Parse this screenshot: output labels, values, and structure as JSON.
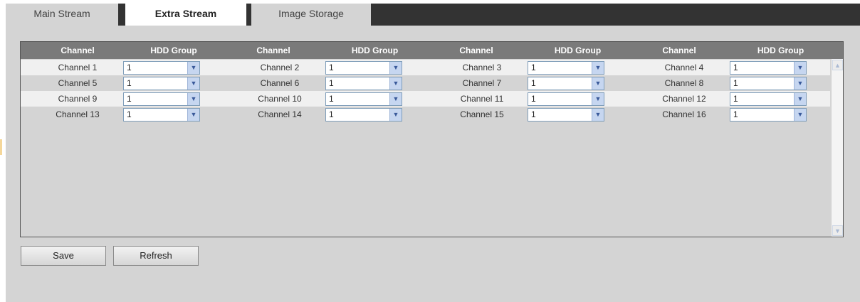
{
  "tabs": [
    {
      "label": "Main Stream"
    },
    {
      "label": "Extra Stream"
    },
    {
      "label": "Image Storage"
    }
  ],
  "table": {
    "headers": [
      "Channel",
      "HDD Group",
      "Channel",
      "HDD Group",
      "Channel",
      "HDD Group",
      "Channel",
      "HDD Group"
    ],
    "rows": [
      [
        {
          "channel": "Channel 1",
          "hdd": "1"
        },
        {
          "channel": "Channel 2",
          "hdd": "1"
        },
        {
          "channel": "Channel 3",
          "hdd": "1"
        },
        {
          "channel": "Channel 4",
          "hdd": "1"
        }
      ],
      [
        {
          "channel": "Channel 5",
          "hdd": "1"
        },
        {
          "channel": "Channel 6",
          "hdd": "1"
        },
        {
          "channel": "Channel 7",
          "hdd": "1"
        },
        {
          "channel": "Channel 8",
          "hdd": "1"
        }
      ],
      [
        {
          "channel": "Channel 9",
          "hdd": "1"
        },
        {
          "channel": "Channel 10",
          "hdd": "1"
        },
        {
          "channel": "Channel 11",
          "hdd": "1"
        },
        {
          "channel": "Channel 12",
          "hdd": "1"
        }
      ],
      [
        {
          "channel": "Channel 13",
          "hdd": "1"
        },
        {
          "channel": "Channel 14",
          "hdd": "1"
        },
        {
          "channel": "Channel 15",
          "hdd": "1"
        },
        {
          "channel": "Channel 16",
          "hdd": "1"
        }
      ]
    ]
  },
  "buttons": {
    "save": "Save",
    "refresh": "Refresh"
  },
  "icons": {
    "dropdown": "chevron-down-icon",
    "scroll_up": "scroll-up-icon",
    "scroll_down": "scroll-down-icon"
  },
  "colors": {
    "tabbar": "#333333",
    "panel": "#d4d4d4",
    "header": "#7a7a7a",
    "active_tab": "#ffffff"
  }
}
